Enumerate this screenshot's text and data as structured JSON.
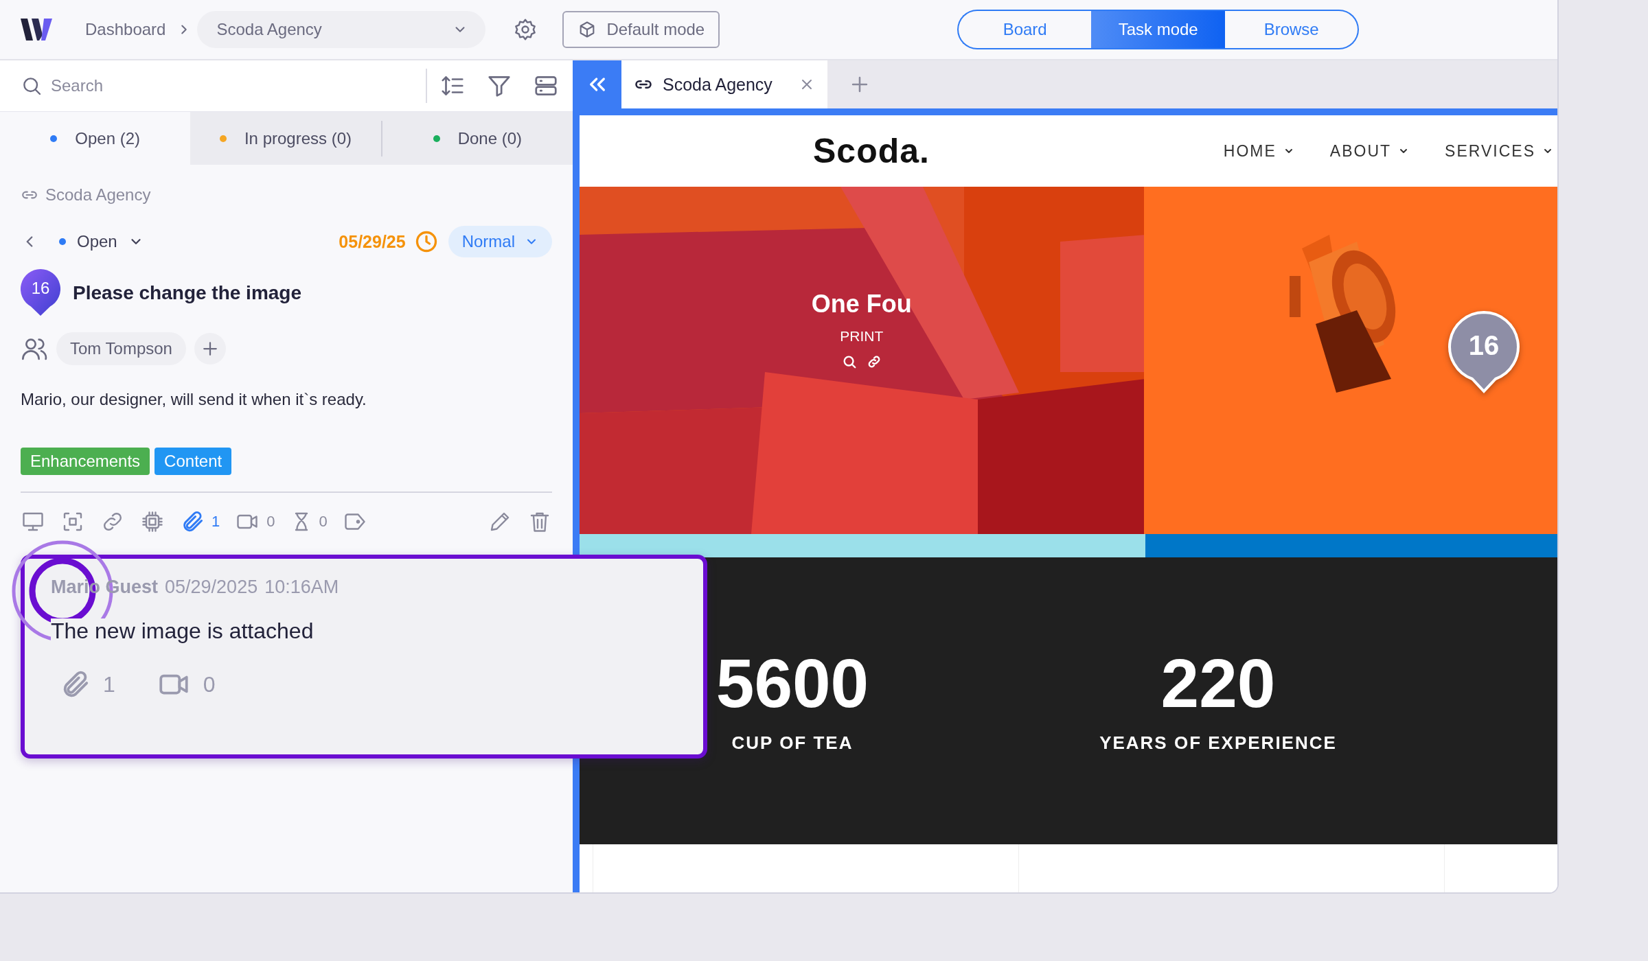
{
  "top_bar": {
    "breadcrumb": "Dashboard",
    "project_select": "Scoda Agency",
    "mode_button": "Default mode",
    "view_modes": [
      {
        "label": "Board",
        "selected": false
      },
      {
        "label": "Task mode",
        "selected": true
      },
      {
        "label": "Browse",
        "selected": false
      }
    ]
  },
  "sidebar": {
    "search": {
      "placeholder": "Search"
    },
    "status_tabs": [
      {
        "label": "Open (2)",
        "color": "#2f7bf5",
        "selected": true
      },
      {
        "label": "In progress (0)",
        "color": "#f5a623",
        "selected": false
      },
      {
        "label": "Done (0)",
        "color": "#1aaf5d",
        "selected": false
      }
    ],
    "task": {
      "project": "Scoda Agency",
      "status": {
        "label": "Open",
        "color": "#2f7bf5"
      },
      "due_date": "05/29/25",
      "priority": "Normal",
      "number": "16",
      "title": "Please change the image",
      "assignees": [
        "Tom Tompson"
      ],
      "description": "Mario, our designer, will send it when it`s ready.",
      "tags": [
        {
          "label": "Enhancements",
          "color": "#4caf50"
        },
        {
          "label": "Content",
          "color": "#2196f3"
        }
      ],
      "counts": {
        "attachments": "1",
        "videos": "0",
        "timers": "0"
      }
    },
    "comment": {
      "author": "Mario Guest",
      "date": "05/29/2025",
      "time": "10:16AM",
      "text": "The new image is attached",
      "attachments": "1",
      "videos": "0"
    }
  },
  "browser": {
    "tab": {
      "title": "Scoda Agency"
    },
    "site": {
      "logo": "Scoda.",
      "nav": [
        "HOME",
        "ABOUT",
        "SERVICES"
      ],
      "portfolio": [
        {
          "kind": "picture",
          "title": "One Fou",
          "subtitle": "PRINT"
        },
        {
          "kind": "picture",
          "pin": "16"
        }
      ],
      "stats": [
        {
          "value": "5600",
          "label": "CUP OF TEA"
        },
        {
          "value": "220",
          "label": "YEARS OF EXPERIENCE"
        }
      ]
    }
  }
}
